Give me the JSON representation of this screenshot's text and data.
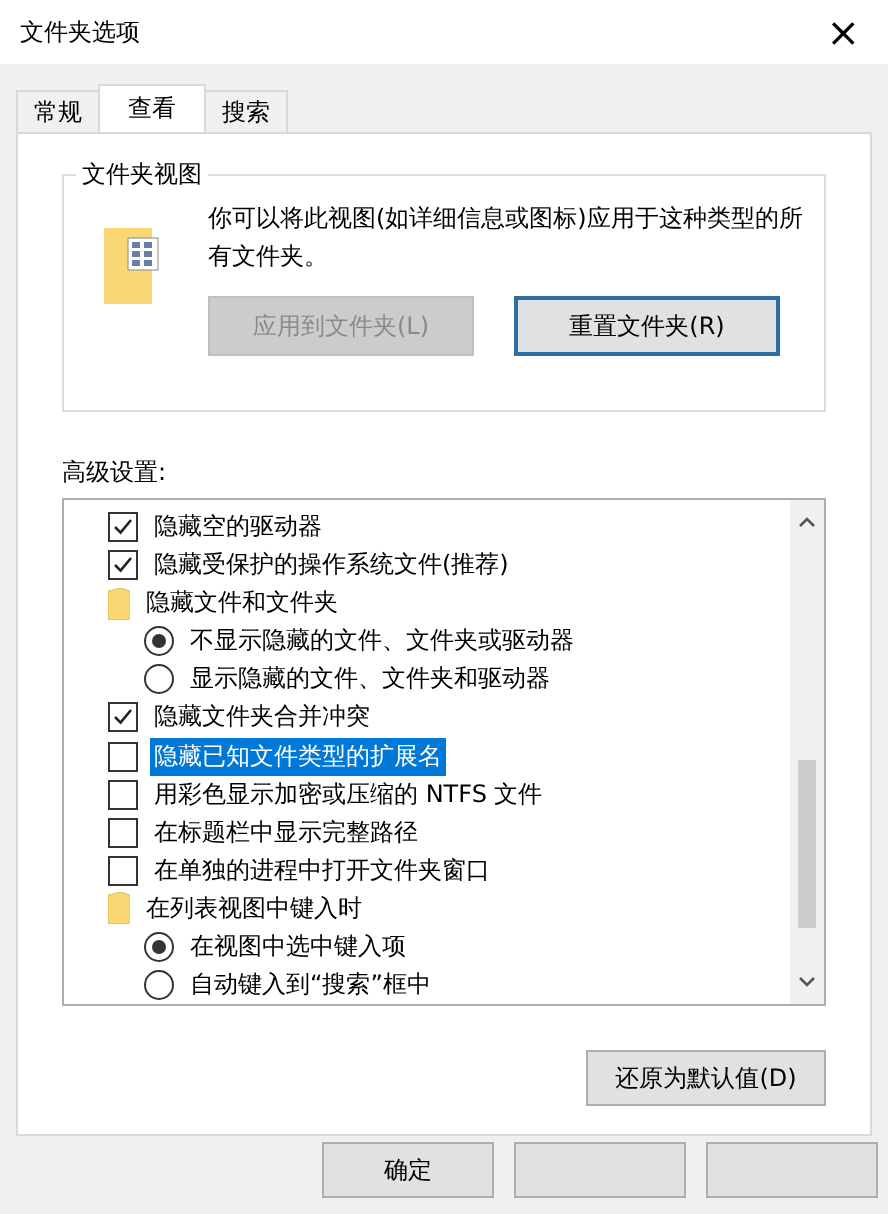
{
  "window": {
    "title": "文件夹选项",
    "close": "×"
  },
  "tabs": [
    {
      "label": "常规",
      "selected": false
    },
    {
      "label": "查看",
      "selected": true
    },
    {
      "label": "搜索",
      "selected": false
    }
  ],
  "folder_views": {
    "title": "文件夹视图",
    "description": "你可以将此视图(如详细信息或图标)应用于这种类型的所有文件夹。",
    "buttons": [
      {
        "label": "应用到文件夹(L)",
        "disabled": true
      },
      {
        "label": "重置文件夹(R)",
        "disabled": false
      }
    ]
  },
  "advanced": {
    "label": "高级设置:",
    "items": [
      {
        "kind": "checkbox",
        "label": "隐藏空的驱动器",
        "checked": true,
        "selected": false
      },
      {
        "kind": "checkbox",
        "label": "隐藏受保护的操作系统文件(推荐)",
        "checked": true,
        "selected": false
      },
      {
        "kind": "folder",
        "label": "隐藏文件和文件夹",
        "selected": false,
        "children": [
          {
            "kind": "radio",
            "label": "不显示隐藏的文件、文件夹或驱动器",
            "checked": true,
            "selected": false
          },
          {
            "kind": "radio",
            "label": "显示隐藏的文件、文件夹和驱动器",
            "checked": false,
            "selected": false
          }
        ]
      },
      {
        "kind": "checkbox",
        "label": "隐藏文件夹合并冲突",
        "checked": true,
        "selected": false
      },
      {
        "kind": "checkbox",
        "label": "隐藏已知文件类型的扩展名",
        "checked": false,
        "selected": true
      },
      {
        "kind": "checkbox",
        "label": "用彩色显示加密或压缩的 NTFS 文件",
        "checked": false,
        "selected": false
      },
      {
        "kind": "checkbox",
        "label": "在标题栏中显示完整路径",
        "checked": false,
        "selected": false
      },
      {
        "kind": "checkbox",
        "label": "在单独的进程中打开文件夹窗口",
        "checked": false,
        "selected": false
      },
      {
        "kind": "folder",
        "label": "在列表视图中键入时",
        "selected": false,
        "children": [
          {
            "kind": "radio",
            "label": "在视图中选中键入项",
            "checked": true,
            "selected": false
          },
          {
            "kind": "radio",
            "label": "自动键入到“搜索”框中",
            "checked": false,
            "selected": false
          }
        ]
      }
    ],
    "restore": "还原为默认值(D)"
  },
  "footer": {
    "ok": "确定"
  }
}
